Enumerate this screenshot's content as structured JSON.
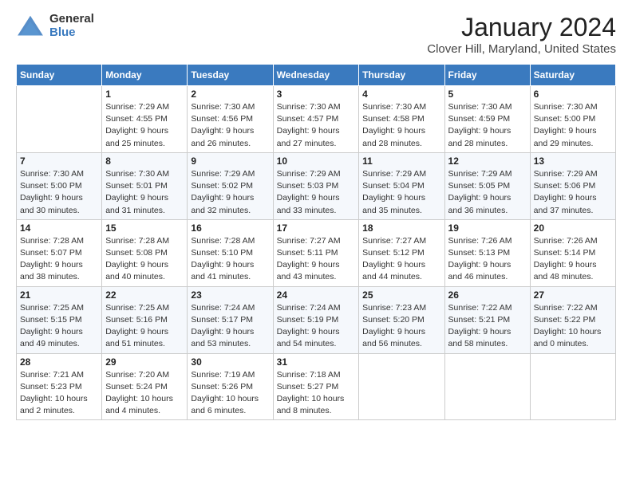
{
  "header": {
    "logo_line1": "General",
    "logo_line2": "Blue",
    "month": "January 2024",
    "location": "Clover Hill, Maryland, United States"
  },
  "weekdays": [
    "Sunday",
    "Monday",
    "Tuesday",
    "Wednesday",
    "Thursday",
    "Friday",
    "Saturday"
  ],
  "weeks": [
    [
      {
        "day": "",
        "sunrise": "",
        "sunset": "",
        "daylight": ""
      },
      {
        "day": "1",
        "sunrise": "Sunrise: 7:29 AM",
        "sunset": "Sunset: 4:55 PM",
        "daylight": "Daylight: 9 hours and 25 minutes."
      },
      {
        "day": "2",
        "sunrise": "Sunrise: 7:30 AM",
        "sunset": "Sunset: 4:56 PM",
        "daylight": "Daylight: 9 hours and 26 minutes."
      },
      {
        "day": "3",
        "sunrise": "Sunrise: 7:30 AM",
        "sunset": "Sunset: 4:57 PM",
        "daylight": "Daylight: 9 hours and 27 minutes."
      },
      {
        "day": "4",
        "sunrise": "Sunrise: 7:30 AM",
        "sunset": "Sunset: 4:58 PM",
        "daylight": "Daylight: 9 hours and 28 minutes."
      },
      {
        "day": "5",
        "sunrise": "Sunrise: 7:30 AM",
        "sunset": "Sunset: 4:59 PM",
        "daylight": "Daylight: 9 hours and 28 minutes."
      },
      {
        "day": "6",
        "sunrise": "Sunrise: 7:30 AM",
        "sunset": "Sunset: 5:00 PM",
        "daylight": "Daylight: 9 hours and 29 minutes."
      }
    ],
    [
      {
        "day": "7",
        "sunrise": "Sunrise: 7:30 AM",
        "sunset": "Sunset: 5:00 PM",
        "daylight": "Daylight: 9 hours and 30 minutes."
      },
      {
        "day": "8",
        "sunrise": "Sunrise: 7:30 AM",
        "sunset": "Sunset: 5:01 PM",
        "daylight": "Daylight: 9 hours and 31 minutes."
      },
      {
        "day": "9",
        "sunrise": "Sunrise: 7:29 AM",
        "sunset": "Sunset: 5:02 PM",
        "daylight": "Daylight: 9 hours and 32 minutes."
      },
      {
        "day": "10",
        "sunrise": "Sunrise: 7:29 AM",
        "sunset": "Sunset: 5:03 PM",
        "daylight": "Daylight: 9 hours and 33 minutes."
      },
      {
        "day": "11",
        "sunrise": "Sunrise: 7:29 AM",
        "sunset": "Sunset: 5:04 PM",
        "daylight": "Daylight: 9 hours and 35 minutes."
      },
      {
        "day": "12",
        "sunrise": "Sunrise: 7:29 AM",
        "sunset": "Sunset: 5:05 PM",
        "daylight": "Daylight: 9 hours and 36 minutes."
      },
      {
        "day": "13",
        "sunrise": "Sunrise: 7:29 AM",
        "sunset": "Sunset: 5:06 PM",
        "daylight": "Daylight: 9 hours and 37 minutes."
      }
    ],
    [
      {
        "day": "14",
        "sunrise": "Sunrise: 7:28 AM",
        "sunset": "Sunset: 5:07 PM",
        "daylight": "Daylight: 9 hours and 38 minutes."
      },
      {
        "day": "15",
        "sunrise": "Sunrise: 7:28 AM",
        "sunset": "Sunset: 5:08 PM",
        "daylight": "Daylight: 9 hours and 40 minutes."
      },
      {
        "day": "16",
        "sunrise": "Sunrise: 7:28 AM",
        "sunset": "Sunset: 5:10 PM",
        "daylight": "Daylight: 9 hours and 41 minutes."
      },
      {
        "day": "17",
        "sunrise": "Sunrise: 7:27 AM",
        "sunset": "Sunset: 5:11 PM",
        "daylight": "Daylight: 9 hours and 43 minutes."
      },
      {
        "day": "18",
        "sunrise": "Sunrise: 7:27 AM",
        "sunset": "Sunset: 5:12 PM",
        "daylight": "Daylight: 9 hours and 44 minutes."
      },
      {
        "day": "19",
        "sunrise": "Sunrise: 7:26 AM",
        "sunset": "Sunset: 5:13 PM",
        "daylight": "Daylight: 9 hours and 46 minutes."
      },
      {
        "day": "20",
        "sunrise": "Sunrise: 7:26 AM",
        "sunset": "Sunset: 5:14 PM",
        "daylight": "Daylight: 9 hours and 48 minutes."
      }
    ],
    [
      {
        "day": "21",
        "sunrise": "Sunrise: 7:25 AM",
        "sunset": "Sunset: 5:15 PM",
        "daylight": "Daylight: 9 hours and 49 minutes."
      },
      {
        "day": "22",
        "sunrise": "Sunrise: 7:25 AM",
        "sunset": "Sunset: 5:16 PM",
        "daylight": "Daylight: 9 hours and 51 minutes."
      },
      {
        "day": "23",
        "sunrise": "Sunrise: 7:24 AM",
        "sunset": "Sunset: 5:17 PM",
        "daylight": "Daylight: 9 hours and 53 minutes."
      },
      {
        "day": "24",
        "sunrise": "Sunrise: 7:24 AM",
        "sunset": "Sunset: 5:19 PM",
        "daylight": "Daylight: 9 hours and 54 minutes."
      },
      {
        "day": "25",
        "sunrise": "Sunrise: 7:23 AM",
        "sunset": "Sunset: 5:20 PM",
        "daylight": "Daylight: 9 hours and 56 minutes."
      },
      {
        "day": "26",
        "sunrise": "Sunrise: 7:22 AM",
        "sunset": "Sunset: 5:21 PM",
        "daylight": "Daylight: 9 hours and 58 minutes."
      },
      {
        "day": "27",
        "sunrise": "Sunrise: 7:22 AM",
        "sunset": "Sunset: 5:22 PM",
        "daylight": "Daylight: 10 hours and 0 minutes."
      }
    ],
    [
      {
        "day": "28",
        "sunrise": "Sunrise: 7:21 AM",
        "sunset": "Sunset: 5:23 PM",
        "daylight": "Daylight: 10 hours and 2 minutes."
      },
      {
        "day": "29",
        "sunrise": "Sunrise: 7:20 AM",
        "sunset": "Sunset: 5:24 PM",
        "daylight": "Daylight: 10 hours and 4 minutes."
      },
      {
        "day": "30",
        "sunrise": "Sunrise: 7:19 AM",
        "sunset": "Sunset: 5:26 PM",
        "daylight": "Daylight: 10 hours and 6 minutes."
      },
      {
        "day": "31",
        "sunrise": "Sunrise: 7:18 AM",
        "sunset": "Sunset: 5:27 PM",
        "daylight": "Daylight: 10 hours and 8 minutes."
      },
      {
        "day": "",
        "sunrise": "",
        "sunset": "",
        "daylight": ""
      },
      {
        "day": "",
        "sunrise": "",
        "sunset": "",
        "daylight": ""
      },
      {
        "day": "",
        "sunrise": "",
        "sunset": "",
        "daylight": ""
      }
    ]
  ]
}
